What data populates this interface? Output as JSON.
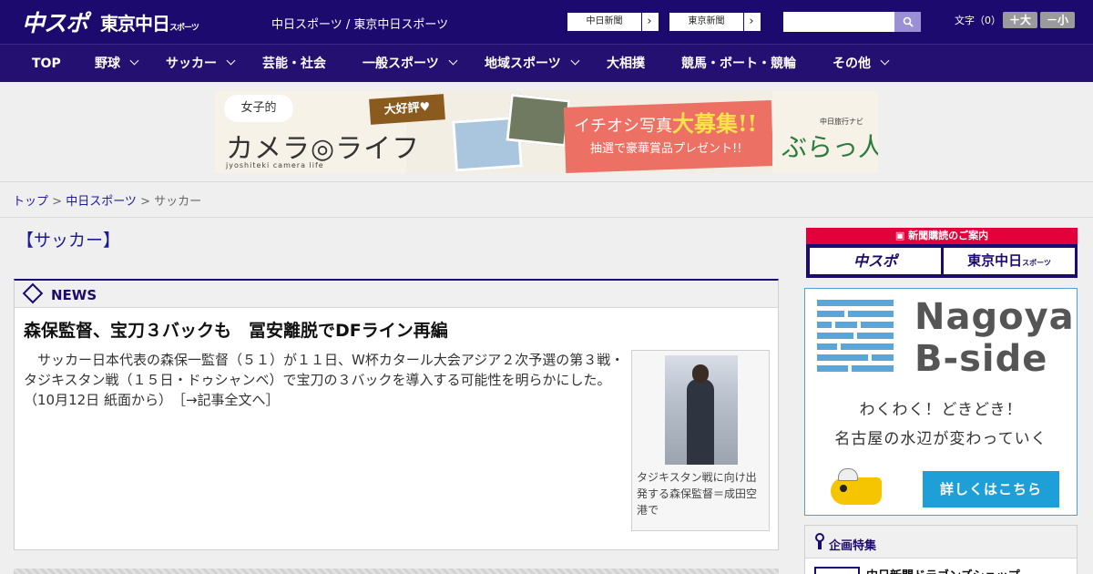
{
  "header": {
    "logo_chunichi_sports": "中スポ",
    "logo_tokyo_chunichi": "東京中日",
    "logo_tokyo_suffix": "スポーツ",
    "site_links": "中日スポーツ / 東京中日スポーツ",
    "link_chunichi_shimbun": "中日新聞",
    "link_tokyo_shimbun": "東京新聞",
    "search_placeholder": "",
    "font_size_label": "文字（0）",
    "font_larger": "＋大",
    "font_smaller": "－小"
  },
  "nav": {
    "items": [
      {
        "label": "TOP",
        "dropdown": false
      },
      {
        "label": "野球",
        "dropdown": true
      },
      {
        "label": "サッカー",
        "dropdown": true
      },
      {
        "label": "芸能・社会",
        "dropdown": false
      },
      {
        "label": "一般スポーツ",
        "dropdown": true
      },
      {
        "label": "地域スポーツ",
        "dropdown": true
      },
      {
        "label": "大相撲",
        "dropdown": false
      },
      {
        "label": "競馬・ボート・競輪",
        "dropdown": false
      },
      {
        "label": "その他",
        "dropdown": true
      }
    ]
  },
  "banner": {
    "bubble": "女子的",
    "title": "カメラ◎ライフ",
    "subtitle": "jyoshiteki camera life",
    "ribbon": "大好評♥",
    "headline_pre": "イチオシ写真",
    "headline_em": "大募集!!",
    "prize": "抽選で豪華賞品プレゼント!!",
    "sponsor_small": "中日旅行ナビ",
    "sponsor_big": "ぶらっ人"
  },
  "breadcrumb": {
    "home": "トップ",
    "sep": " > ",
    "section": "中日スポーツ",
    "current": "サッカー"
  },
  "main": {
    "section_title": "【サッカー】",
    "news_label": "NEWS",
    "headline": "森保監督、宝刀３バックも　冨安離脱でDFライン再編",
    "body": "　サッカー日本代表の森保一監督（５１）が１１日、W杯カタール大会アジア２次予選の第３戦・タジキスタン戦（１５日・ドゥシャンベ）で宝刀の３バックを導入する可能性を明らかにした。（10月12日 紙面から）",
    "read_more": "［→記事全文へ］",
    "photo_caption": "タジキスタン戦に向け出発する森保監督＝成田空港で"
  },
  "sidebar": {
    "subscribe_header": "新聞購読のご案内",
    "subscribe_chunichi": "中スポ",
    "subscribe_tokyo": "東京中日",
    "subscribe_tokyo_suffix": "スポーツ",
    "promo_title_line1": "Nagoya",
    "promo_title_line2": "B-side",
    "promo_line1": "わくわく！どきどき！",
    "promo_line2": "名古屋の水辺が変わっていく",
    "promo_cta": "詳しくはこちら",
    "feature_label": "企画特集",
    "feature_item": "中日新聞ドラゴンズショップ"
  },
  "colors": {
    "header_bg": "#1c0a6e",
    "nav_bg": "#241070",
    "link": "#1a1a9a",
    "subscribe_red": "#e4003a",
    "promo_blue": "#1e9fd8"
  }
}
